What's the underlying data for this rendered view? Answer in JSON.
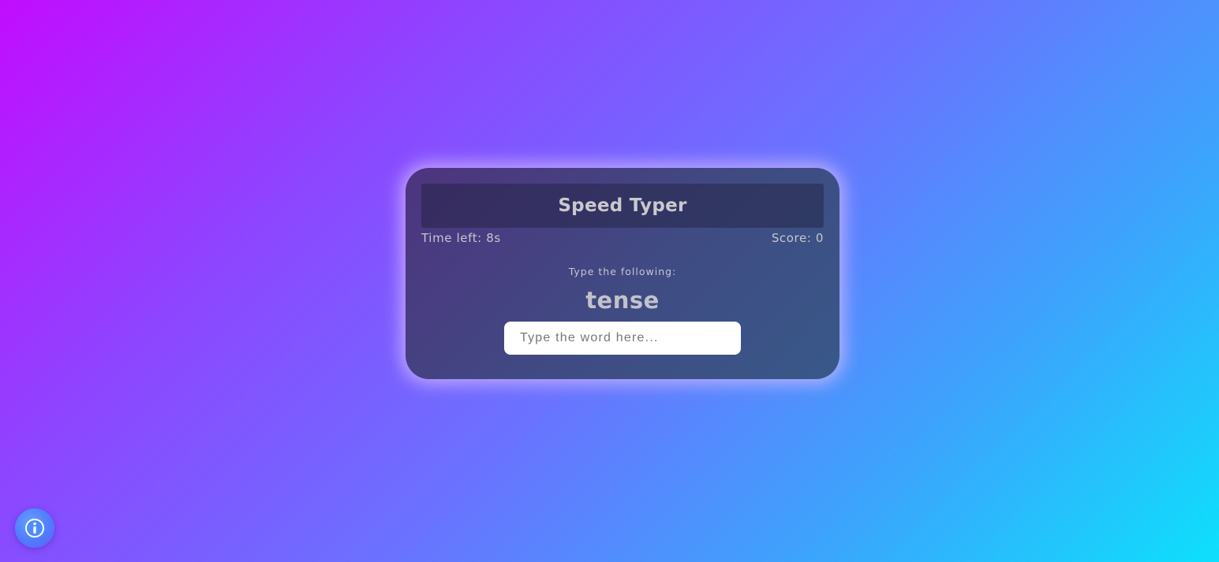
{
  "game": {
    "title": "Speed Typer",
    "time_left_label": "Time left: 8s",
    "score_label": "Score: 0",
    "prompt": "Type the following:",
    "current_word": "tense",
    "input": {
      "value": "",
      "placeholder": "Type the word here..."
    }
  },
  "info_button": {
    "icon": "info-icon"
  },
  "colors": {
    "background_start": "#c20cff",
    "background_end": "#0de0fc",
    "card_glow": "#d7beff"
  }
}
